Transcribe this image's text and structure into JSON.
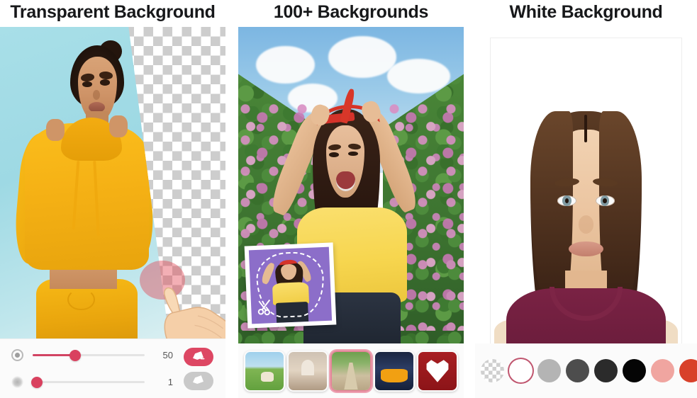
{
  "panels": [
    {
      "id": "transparent-background",
      "title": "Transparent Background",
      "editor": {
        "brush_indicator": "brush-circle",
        "cursor": "pointing-hand",
        "subject": "woman-yellow-hoodie",
        "original_background_color": "#a8dfe8",
        "erased_area": "checkerboard-transparency"
      },
      "controls": {
        "sliders": [
          {
            "name": "brush-size",
            "icon": "ring-dot-icon",
            "value": "50",
            "percent": 38
          },
          {
            "name": "brush-hardness",
            "icon": "soft-dot-icon",
            "value": "1",
            "percent": 4
          }
        ],
        "tools": [
          {
            "name": "eraser-remove",
            "icon": "eraser-minus-icon",
            "state": "active",
            "color": "#dd4763"
          },
          {
            "name": "eraser-restore",
            "icon": "eraser-icon",
            "state": "inactive",
            "color": "#c9c9c9"
          }
        ]
      }
    },
    {
      "id": "backgrounds-library",
      "title": "100+ Backgrounds",
      "editor": {
        "subject": "woman-red-headband-yellow-shirt",
        "applied_background": "flower-garden-path",
        "inset_card": {
          "label": "cutout-preview",
          "background_color": "#8c6ec9",
          "icon": "scissors-icon",
          "outline": "dashed-cut-path"
        }
      },
      "thumbnails": [
        {
          "name": "thumb-meadow-horse",
          "selected": false,
          "class": "t1"
        },
        {
          "name": "thumb-taj-mahal",
          "selected": false,
          "class": "t2"
        },
        {
          "name": "thumb-garden-path",
          "selected": true,
          "class": "t3"
        },
        {
          "name": "thumb-sports-car",
          "selected": false,
          "class": "t4"
        },
        {
          "name": "thumb-heart-roses",
          "selected": false,
          "class": "t5"
        }
      ]
    },
    {
      "id": "white-background",
      "title": "White Background",
      "editor": {
        "subject": "passport-portrait-woman",
        "applied_background": "#ffffff",
        "sweater_color": "#7a2244"
      },
      "swatches": [
        {
          "name": "swatch-transparent",
          "color": "transparent",
          "selected": false
        },
        {
          "name": "swatch-white",
          "color": "#ffffff",
          "selected": true
        },
        {
          "name": "swatch-light-gray",
          "color": "#b4b4b4",
          "selected": false
        },
        {
          "name": "swatch-dark-gray",
          "color": "#4d4d4d",
          "selected": false
        },
        {
          "name": "swatch-charcoal",
          "color": "#2b2b2b",
          "selected": false
        },
        {
          "name": "swatch-black",
          "color": "#050505",
          "selected": false
        },
        {
          "name": "swatch-pink",
          "color": "#f0a5a0",
          "selected": false
        },
        {
          "name": "swatch-red",
          "color": "#d8412a",
          "selected": false
        },
        {
          "name": "swatch-orange",
          "color": "#ef8b12",
          "selected": false
        },
        {
          "name": "swatch-yellow",
          "color": "#f3d618",
          "selected": false
        }
      ]
    }
  ],
  "theme": {
    "accent": "#d9415f",
    "selection_ring": "#c0566f",
    "panel_bg": "#fbfbfb",
    "page_bg": "#ffffff",
    "title_color": "#17181a"
  }
}
